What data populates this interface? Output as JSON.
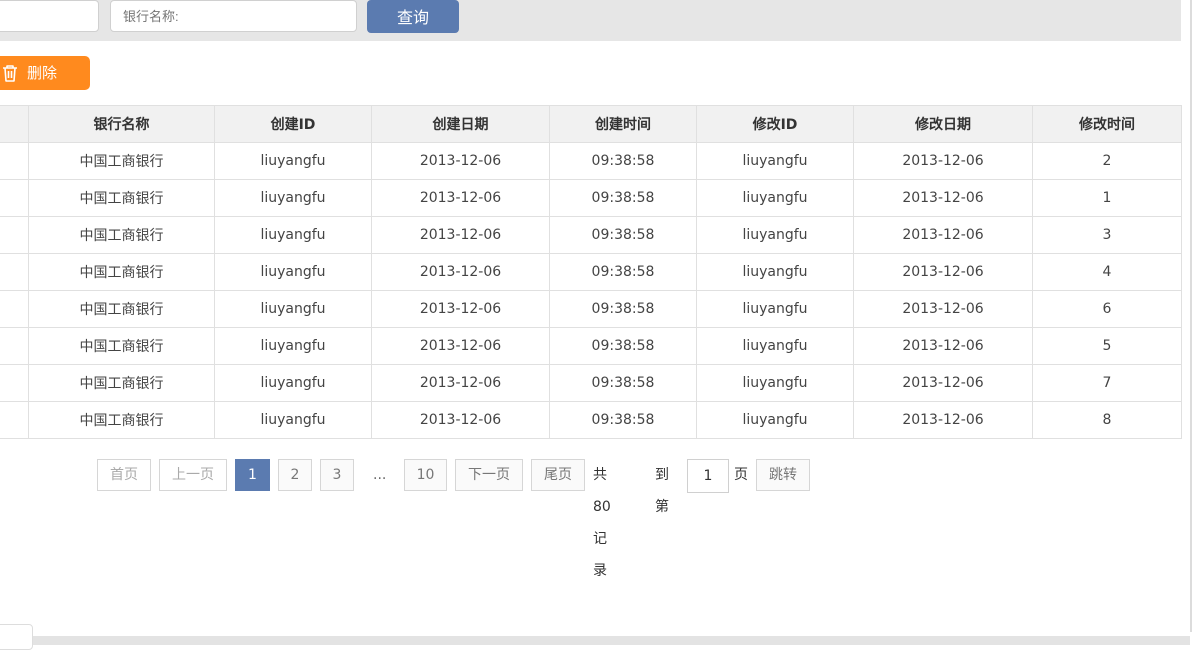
{
  "search": {
    "left_input_value": "",
    "bank_name_placeholder": "银行名称:",
    "query_label": "查询"
  },
  "toolbar": {
    "delete_label": "删除"
  },
  "table": {
    "headers": [
      "银行名称",
      "创建ID",
      "创建日期",
      "创建时间",
      "修改ID",
      "修改日期",
      "修改时间"
    ],
    "rows": [
      [
        "中国工商银行",
        "liuyangfu",
        "2013-12-06",
        "09:38:58",
        "liuyangfu",
        "2013-12-06",
        "2"
      ],
      [
        "中国工商银行",
        "liuyangfu",
        "2013-12-06",
        "09:38:58",
        "liuyangfu",
        "2013-12-06",
        "1"
      ],
      [
        "中国工商银行",
        "liuyangfu",
        "2013-12-06",
        "09:38:58",
        "liuyangfu",
        "2013-12-06",
        "3"
      ],
      [
        "中国工商银行",
        "liuyangfu",
        "2013-12-06",
        "09:38:58",
        "liuyangfu",
        "2013-12-06",
        "4"
      ],
      [
        "中国工商银行",
        "liuyangfu",
        "2013-12-06",
        "09:38:58",
        "liuyangfu",
        "2013-12-06",
        "6"
      ],
      [
        "中国工商银行",
        "liuyangfu",
        "2013-12-06",
        "09:38:58",
        "liuyangfu",
        "2013-12-06",
        "5"
      ],
      [
        "中国工商银行",
        "liuyangfu",
        "2013-12-06",
        "09:38:58",
        "liuyangfu",
        "2013-12-06",
        "7"
      ],
      [
        "中国工商银行",
        "liuyangfu",
        "2013-12-06",
        "09:38:58",
        "liuyangfu",
        "2013-12-06",
        "8"
      ]
    ]
  },
  "pager": {
    "first": "首页",
    "prev": "上一页",
    "pages": [
      "1",
      "2",
      "3"
    ],
    "current": "1",
    "ellipsis": "...",
    "last_page": "10",
    "next": "下一页",
    "last": "尾页",
    "total_text": "共80记录",
    "goto_prefix": "到第",
    "goto_value": "1",
    "goto_suffix": "页",
    "jump": "跳转"
  },
  "colors": {
    "accent": "#5b7bb0",
    "delete": "#ff8a1e"
  }
}
